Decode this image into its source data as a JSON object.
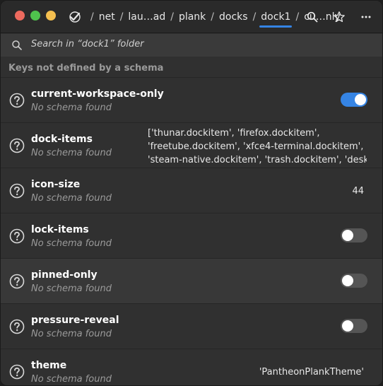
{
  "breadcrumbs": [
    "net",
    "lau…ad",
    "plank",
    "docks",
    "dock1",
    "cu…nly"
  ],
  "search": {
    "placeholder": "Search in “dock1” folder"
  },
  "section_title": "Keys not defined by a schema",
  "rows": [
    {
      "key": "current-workspace-only",
      "sub": "No schema found",
      "type": "toggle",
      "on": true
    },
    {
      "key": "dock-items",
      "sub": "No schema found",
      "type": "text",
      "value_lines": [
        "['thunar.dockitem', 'firefox.dockitem',",
        "'freetube.dockitem', 'xfce4-terminal.dockitem',",
        "'steam-native.dockitem', 'trash.dockitem', 'desk…"
      ]
    },
    {
      "key": "icon-size",
      "sub": "No schema found",
      "type": "value",
      "value": "44"
    },
    {
      "key": "lock-items",
      "sub": "No schema found",
      "type": "toggle",
      "on": false
    },
    {
      "key": "pinned-only",
      "sub": "No schema found",
      "type": "toggle",
      "on": false
    },
    {
      "key": "pressure-reveal",
      "sub": "No schema found",
      "type": "toggle",
      "on": false
    },
    {
      "key": "theme",
      "sub": "No schema found",
      "type": "value",
      "value": "'PantheonPlankTheme'"
    }
  ],
  "colors": {
    "accent": "#3584e4",
    "close": "#ed6a5e",
    "maximize": "#4fc24d",
    "minimize": "#f4bf4f"
  },
  "icons": [
    "dconf-root-icon",
    "search-icon",
    "star-icon",
    "menu-icon",
    "help-icon"
  ]
}
